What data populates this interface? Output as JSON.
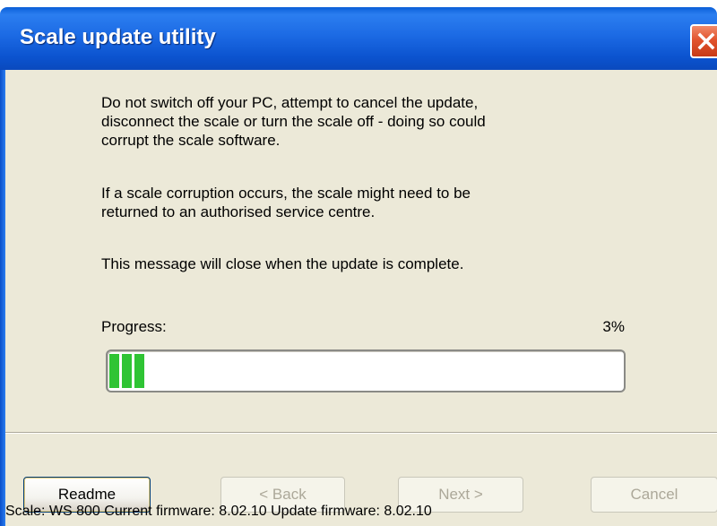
{
  "window": {
    "title": "Scale update utility",
    "close_icon": "close-icon"
  },
  "message": {
    "paragraph1": "Do not switch off your PC, attempt to cancel the update,\ndisconnect the scale or turn the scale off - doing so could\ncorrupt the scale software.",
    "paragraph2": "If a scale corruption occurs, the scale might need to be\nreturned to an authorised service centre.",
    "paragraph3": "This message will close when the update is complete."
  },
  "progress": {
    "label": "Progress:",
    "percent_text": "3%",
    "value": 0.03,
    "fill_color": "#2fc434"
  },
  "buttons": {
    "readme": "Readme",
    "back": "< Back",
    "next": "Next >",
    "cancel": "Cancel"
  },
  "status": {
    "text": "Scale: WS 800 Current firmware: 8.02.10 Update firmware: 8.02.10"
  },
  "colors": {
    "titlebar": "#0b53cf",
    "client_background": "#ece9d8",
    "close_button": "#e2542e"
  }
}
